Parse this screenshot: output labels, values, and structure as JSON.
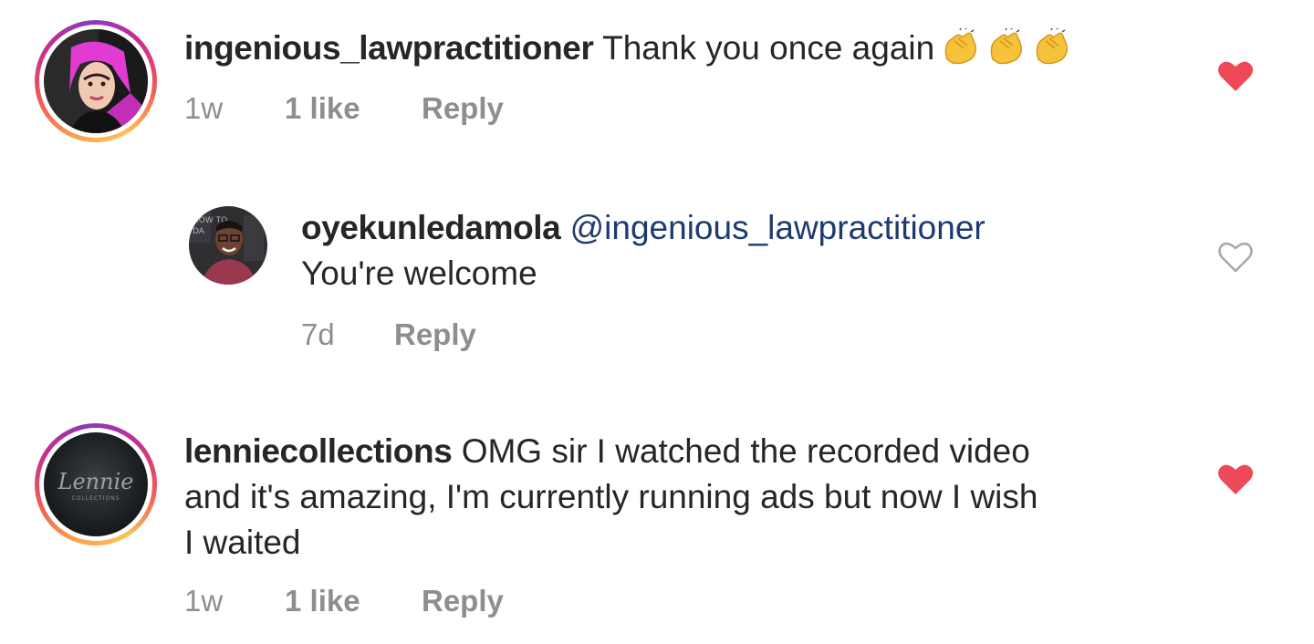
{
  "comments": [
    {
      "username": "ingenious_lawpractitioner",
      "text": "Thank you once again",
      "emoji": [
        "clapping-hands",
        "clapping-hands",
        "clapping-hands"
      ],
      "time": "1w",
      "likes": "1 like",
      "reply": "Reply",
      "liked": true,
      "heart_color": "#ed4956"
    },
    {
      "username": "oyekunledamola",
      "mention": "@ingenious_lawpractitioner",
      "text": "You're welcome",
      "time": "7d",
      "reply": "Reply",
      "liked": false
    },
    {
      "username": "lenniecollections",
      "text_line1": "OMG sir I watched the recorded video",
      "text_line2": "and it's amazing, I'm currently running ads but now I wish",
      "text_line3": "I waited",
      "time": "1w",
      "likes": "1 like",
      "reply": "Reply",
      "liked": true,
      "avatar_logo": "Lennie",
      "avatar_logo_sub": "COLLECTIONS"
    }
  ],
  "colors": {
    "text": "#262626",
    "meta": "#8e8e8e",
    "mention": "#1e3a6e",
    "heart_liked": "#ed4956",
    "heart_outline": "#a8a8a8"
  }
}
